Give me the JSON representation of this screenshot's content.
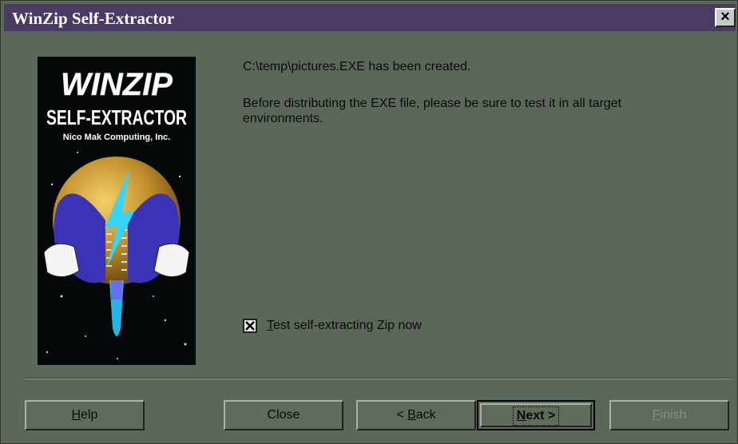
{
  "window": {
    "title": "WinZip Self-Extractor",
    "close_glyph": "×"
  },
  "logo": {
    "brand": "WINZIP",
    "subtitle": "SELF-EXTRACTOR",
    "company": "Nico Mak Computing, Inc.",
    "icon": "zipper-globe-lightning-icon"
  },
  "message": {
    "created": "C:\\temp\\pictures.EXE has been created.",
    "advice": "Before distributing the EXE file, please be sure to test it in all target environments."
  },
  "checkbox": {
    "checked": true,
    "mnemonic": "T",
    "label_rest": "est self-extracting Zip now"
  },
  "buttons": {
    "help": {
      "mnemonic": "H",
      "rest": "elp"
    },
    "close": {
      "label": "Close"
    },
    "back": {
      "prefix": "< ",
      "mnemonic": "B",
      "rest": "ack"
    },
    "next": {
      "mnemonic": "N",
      "rest": "ext >"
    },
    "finish": {
      "mnemonic": "F",
      "rest": "inish",
      "disabled": true
    }
  },
  "colors": {
    "titlebar": "#4a3b63",
    "dialog_bg": "#5b6859"
  }
}
